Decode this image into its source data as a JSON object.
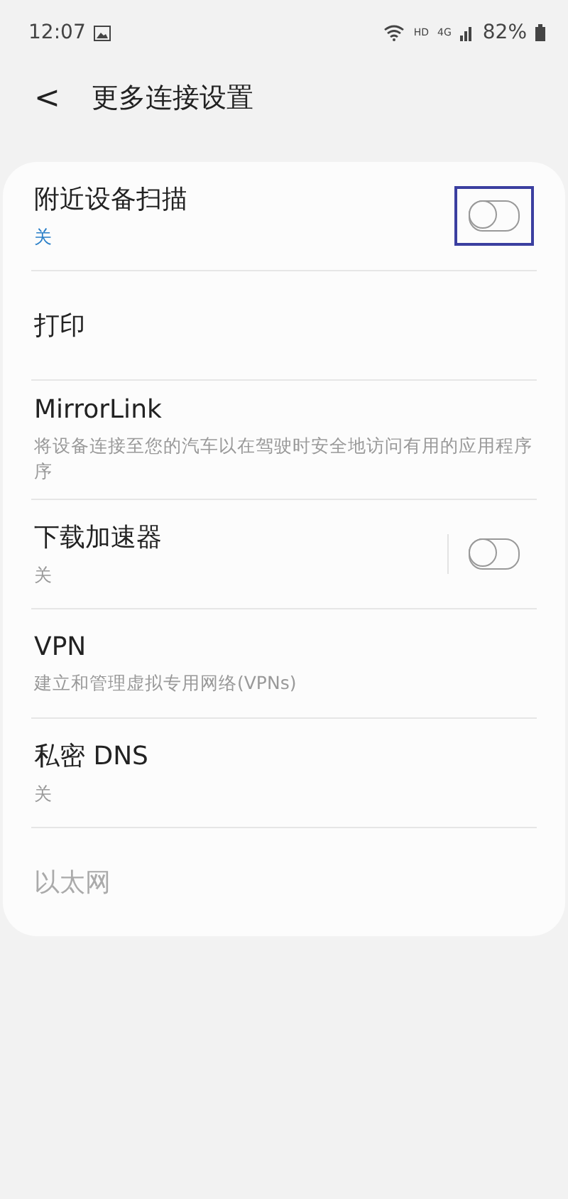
{
  "status_bar": {
    "time": "12:07",
    "hd": "HD",
    "network": "4G",
    "battery": "82%"
  },
  "header": {
    "back": "<",
    "title": "更多连接设置"
  },
  "items": [
    {
      "kind": "toggle",
      "title": "附近设备扫描",
      "subtitle": "关",
      "color": "#2a7fc8",
      "on": false,
      "highlighted": true,
      "divider": false,
      "disabled": false
    },
    {
      "kind": "plain",
      "title": "打印",
      "disabled": false
    },
    {
      "kind": "plain",
      "title": "MirrorLink",
      "subtitle": "将设备连接至您的汽车以在驾驶时安全地访问有用的应用程序序",
      "color": "#999999",
      "disabled": false
    },
    {
      "kind": "toggle",
      "title": "下载加速器",
      "subtitle": "关",
      "color": "#999999",
      "on": false,
      "highlighted": false,
      "divider": true,
      "disabled": false
    },
    {
      "kind": "plain",
      "title": "VPN",
      "subtitle": "建立和管理虚拟专用网络(VPNs)",
      "color": "#999999",
      "disabled": false
    },
    {
      "kind": "plain",
      "title": "私密 DNS",
      "subtitle": "关",
      "color": "#999999",
      "disabled": false
    },
    {
      "kind": "plain",
      "title": "以太网",
      "disabled": true
    }
  ]
}
